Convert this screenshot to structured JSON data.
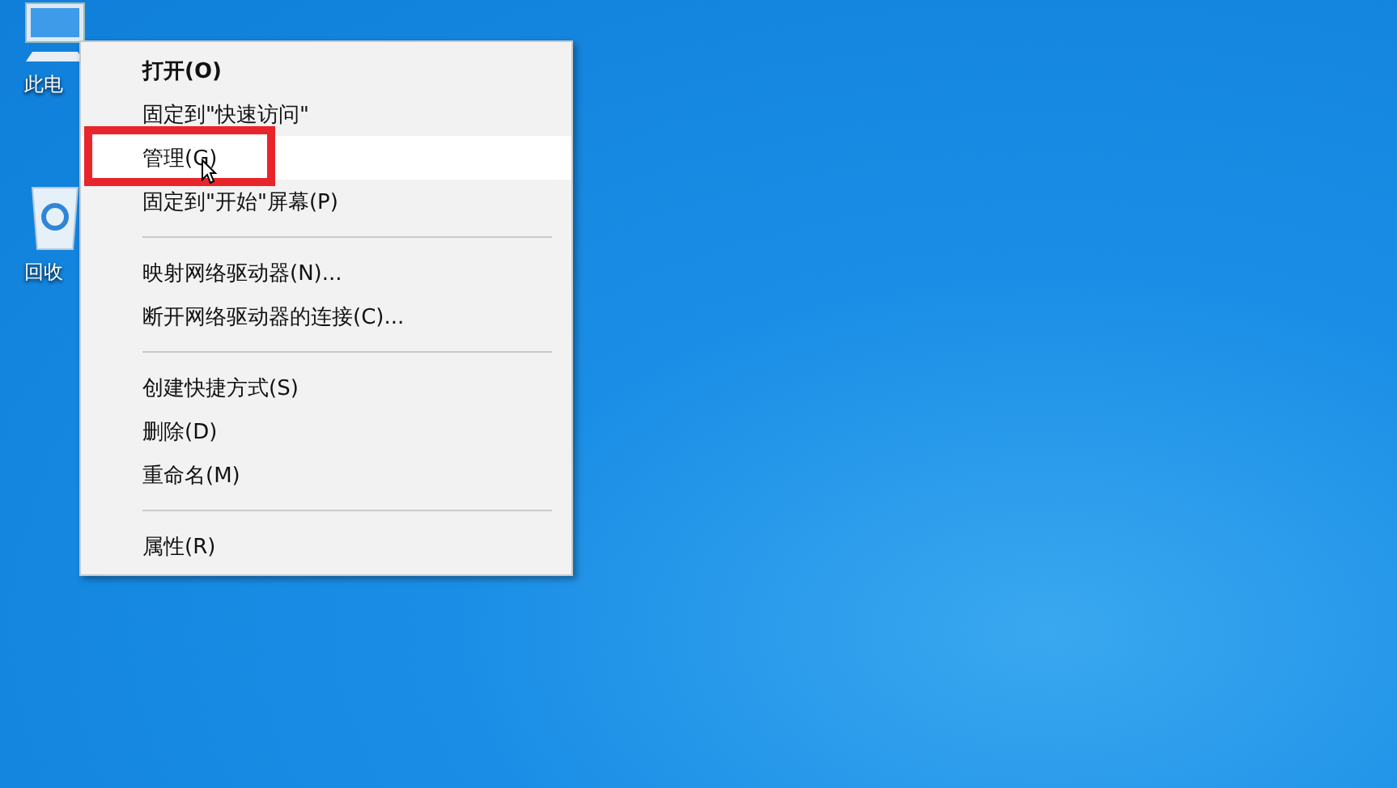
{
  "desktop_icons": [
    {
      "kind": "computer",
      "label": "此电"
    },
    {
      "kind": "recycle",
      "label": "回收"
    }
  ],
  "context_menu": {
    "items": [
      {
        "kind": "item",
        "label": "打开(O)",
        "bold": true,
        "selected": false,
        "annotated": false
      },
      {
        "kind": "item",
        "label": "固定到\"快速访问\"",
        "bold": false,
        "selected": false,
        "annotated": false
      },
      {
        "kind": "item",
        "label": "管理(G)",
        "bold": false,
        "selected": true,
        "annotated": true
      },
      {
        "kind": "item",
        "label": "固定到\"开始\"屏幕(P)",
        "bold": false,
        "selected": false,
        "annotated": false
      },
      {
        "kind": "separator"
      },
      {
        "kind": "item",
        "label": "映射网络驱动器(N)...",
        "bold": false,
        "selected": false,
        "annotated": false
      },
      {
        "kind": "item",
        "label": "断开网络驱动器的连接(C)...",
        "bold": false,
        "selected": false,
        "annotated": false
      },
      {
        "kind": "separator"
      },
      {
        "kind": "item",
        "label": "创建快捷方式(S)",
        "bold": false,
        "selected": false,
        "annotated": false
      },
      {
        "kind": "item",
        "label": "删除(D)",
        "bold": false,
        "selected": false,
        "annotated": false
      },
      {
        "kind": "item",
        "label": "重命名(M)",
        "bold": false,
        "selected": false,
        "annotated": false
      },
      {
        "kind": "separator"
      },
      {
        "kind": "item",
        "label": "属性(R)",
        "bold": false,
        "selected": false,
        "annotated": false
      }
    ]
  }
}
